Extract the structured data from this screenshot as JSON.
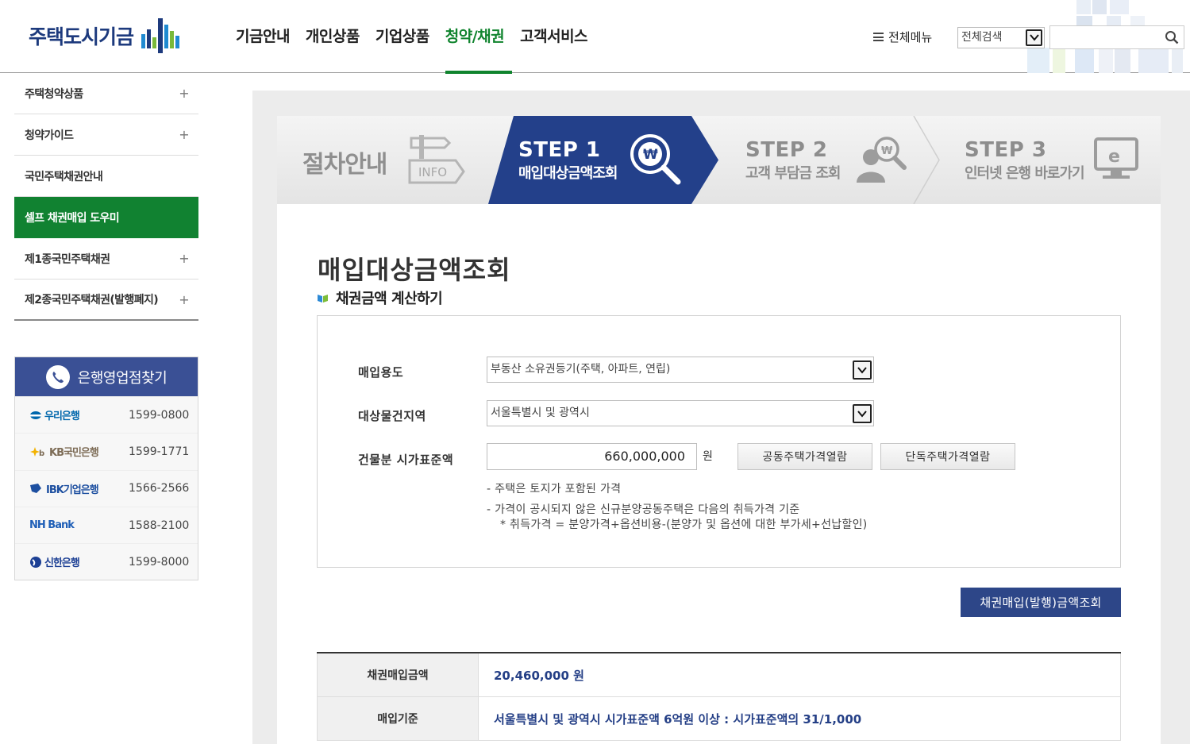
{
  "header": {
    "logo_text": "주택도시기금",
    "nav": [
      "기금안내",
      "개인상품",
      "기업상품",
      "청약/채권",
      "고객서비스"
    ],
    "active_nav": "청약/채권",
    "all_menu": "전체메뉴",
    "search_scope": "전체검색",
    "search_value": ""
  },
  "sidebar": {
    "items": [
      {
        "label": "주택청약상품",
        "expand": "+"
      },
      {
        "label": "청약가이드",
        "expand": "+"
      },
      {
        "label": "국민주택채권안내",
        "expand": ""
      },
      {
        "label": "셀프 채권매입 도우미",
        "expand": ""
      },
      {
        "label": "제1종국민주택채권",
        "expand": "+"
      },
      {
        "label": "제2종국민주택채권(발행폐지)",
        "expand": "+"
      }
    ],
    "active_item": "셀프 채권매입 도우미",
    "bank_box": {
      "title": "은행영업점찾기",
      "banks": [
        {
          "name": "우리은행",
          "tel": "1599-0800",
          "color": "#0067ac"
        },
        {
          "name": "KB국민은행",
          "tel": "1599-1771",
          "color": "#7d6c56"
        },
        {
          "name": "IBK기업은행",
          "tel": "1566-2566",
          "color": "#1d4fa0"
        },
        {
          "name": "NH Bank",
          "tel": "1588-2100",
          "color": "#1f5fb7"
        },
        {
          "name": "신한은행",
          "tel": "1599-8000",
          "color": "#1c3f94"
        }
      ]
    }
  },
  "steps": {
    "intro_label": "절차안내",
    "intro_icon_text": "INFO",
    "step1": {
      "title": "STEP 1",
      "sub": "매입대상금액조회"
    },
    "step2": {
      "title": "STEP 2",
      "sub": "고객 부담금 조회"
    },
    "step3": {
      "title": "STEP 3",
      "sub": "인터넷 은행 바로가기"
    }
  },
  "main": {
    "page_title": "매입대상금액조회",
    "section_title": "채권금액 계산하기",
    "form": {
      "purpose_label": "매입용도",
      "purpose_value": "부동산 소유권등기(주택, 아파트, 연립)",
      "region_label": "대상물건지역",
      "region_value": "서울특별시 및 광역시",
      "price_label": "건물분 시가표준액",
      "price_value": "660,000,000",
      "price_unit": "원",
      "btn_apt": "공동주택가격열람",
      "btn_house": "단독주택가격열람",
      "note1": "- 주택은 토지가 포함된 가격",
      "note2": "- 가격이 공시되지 않은 신규분양공동주택은 다음의 취득가격 기준",
      "note3": "* 취득가격 = 분양가격+옵션비용-(분양가 및 옵션에 대한 부가세+선납할인)"
    },
    "lookup_button": "채권매입(발행)금액조회",
    "result": {
      "amount_label": "채권매입금액",
      "amount_value": "20,460,000 원",
      "basis_label": "매입기준",
      "basis_value": "서울특별시 및 광역시 시가표준액 6억원 이상 : 시가표준액의 31/1,000"
    }
  },
  "colors": {
    "accent_green": "#10842e",
    "navy": "#2d4688",
    "step_active": "#23408a"
  }
}
